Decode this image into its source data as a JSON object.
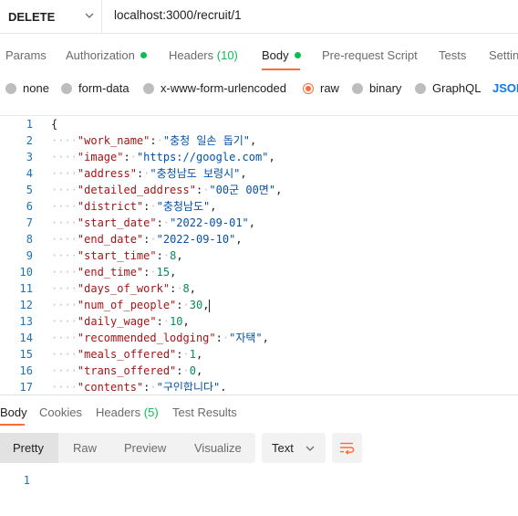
{
  "request": {
    "method": "DELETE",
    "url": "localhost:3000/recruit/1"
  },
  "request_tabs": [
    {
      "label": "Params"
    },
    {
      "label": "Authorization",
      "dot": true
    },
    {
      "label": "Headers",
      "count": "(10)"
    },
    {
      "label": "Body",
      "dot": true,
      "active": true
    },
    {
      "label": "Pre-request Script"
    },
    {
      "label": "Tests"
    },
    {
      "label": "Settin"
    }
  ],
  "body_types": [
    {
      "label": "none"
    },
    {
      "label": "form-data"
    },
    {
      "label": "x-www-form-urlencoded"
    },
    {
      "label": "raw",
      "selected": true
    },
    {
      "label": "binary"
    },
    {
      "label": "GraphQL"
    }
  ],
  "raw_language": "JSON",
  "editor": {
    "lines": [
      {
        "n": "1",
        "open": "{"
      },
      {
        "n": "2",
        "key": "\"work_name\"",
        "value": "\"충청 일손 돕기\"",
        "vtype": "s"
      },
      {
        "n": "3",
        "key": "\"image\"",
        "value": "\"https://google.com\"",
        "vtype": "s"
      },
      {
        "n": "4",
        "key": "\"address\"",
        "value": "\"충청남도 보령시\"",
        "vtype": "s"
      },
      {
        "n": "5",
        "key": "\"detailed_address\"",
        "value": "\"00군 00면\"",
        "vtype": "s"
      },
      {
        "n": "6",
        "key": "\"district\"",
        "value": "\"충청남도\"",
        "vtype": "s"
      },
      {
        "n": "7",
        "key": "\"start_date\"",
        "value": "\"2022-09-01\"",
        "vtype": "s"
      },
      {
        "n": "8",
        "key": "\"end_date\"",
        "value": "\"2022-09-10\"",
        "vtype": "s"
      },
      {
        "n": "9",
        "key": "\"start_time\"",
        "value": "8",
        "vtype": "n"
      },
      {
        "n": "10",
        "key": "\"end_time\"",
        "value": "15",
        "vtype": "n"
      },
      {
        "n": "11",
        "key": "\"days_of_work\"",
        "value": "8",
        "vtype": "n"
      },
      {
        "n": "12",
        "key": "\"num_of_people\"",
        "value": "30",
        "vtype": "n"
      },
      {
        "n": "13",
        "key": "\"daily_wage\"",
        "value": "10",
        "vtype": "n"
      },
      {
        "n": "14",
        "key": "\"recommended_lodging\"",
        "value": "\"자택\"",
        "vtype": "s"
      },
      {
        "n": "15",
        "key": "\"meals_offered\"",
        "value": "1",
        "vtype": "n"
      },
      {
        "n": "16",
        "key": "\"trans_offered\"",
        "value": "0",
        "vtype": "n"
      },
      {
        "n": "17",
        "key": "\"contents\"",
        "value": "\"구인합니다\"",
        "vtype": "s"
      }
    ]
  },
  "response_tabs": [
    {
      "label": "Body",
      "active": true
    },
    {
      "label": "Cookies"
    },
    {
      "label": "Headers",
      "count": "(5)"
    },
    {
      "label": "Test Results"
    }
  ],
  "response_views": [
    {
      "label": "Pretty",
      "active": true
    },
    {
      "label": "Raw"
    },
    {
      "label": "Preview"
    },
    {
      "label": "Visualize"
    }
  ],
  "response_format": "Text",
  "response_body": {
    "lines": [
      {
        "n": "1",
        "text": ""
      }
    ]
  },
  "colors": {
    "accent": "#ff6c37",
    "success": "#0cbb52",
    "link": "#097bed"
  },
  "icons": {
    "method_dropdown": "chevron-down-icon",
    "format_dropdown": "chevron-down-icon",
    "wrap": "wrap-lines-icon"
  }
}
